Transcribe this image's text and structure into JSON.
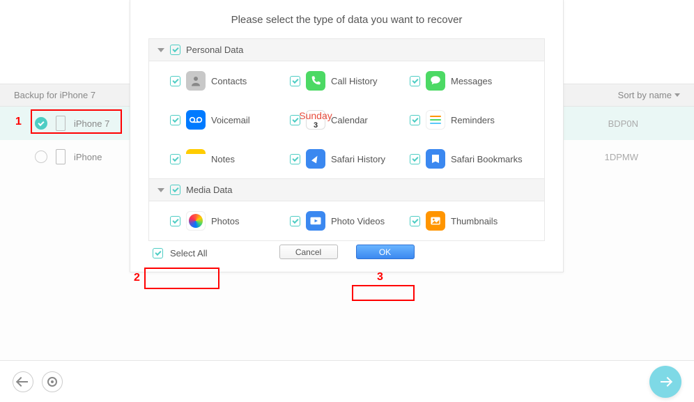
{
  "window": {
    "traffic": true
  },
  "toolbar": {
    "left": "Backup for iPhone 7",
    "sort_label": "Sort by name"
  },
  "devices": [
    {
      "name": "iPhone 7",
      "selected": true,
      "serial_tail": "BDP0N"
    },
    {
      "name": "iPhone",
      "selected": false,
      "serial_tail": "1DPMW"
    }
  ],
  "modal": {
    "title": "Please select the type of data you want to recover",
    "sections": [
      {
        "label": "Personal Data",
        "items": [
          [
            {
              "label": "Contacts",
              "icon": "contacts"
            },
            {
              "label": "Call History",
              "icon": "call"
            },
            {
              "label": "Messages",
              "icon": "msg"
            }
          ],
          [
            {
              "label": "Voicemail",
              "icon": "vm"
            },
            {
              "label": "Calendar",
              "icon": "cal"
            },
            {
              "label": "Reminders",
              "icon": "rem"
            }
          ],
          [
            {
              "label": "Notes",
              "icon": "notes"
            },
            {
              "label": "Safari History",
              "icon": "safari"
            },
            {
              "label": "Safari Bookmarks",
              "icon": "book"
            }
          ]
        ]
      },
      {
        "label": "Media Data",
        "items": [
          [
            {
              "label": "Photos",
              "icon": "photos"
            },
            {
              "label": "Photo Videos",
              "icon": "pv"
            },
            {
              "label": "Thumbnails",
              "icon": "thumb"
            }
          ]
        ]
      }
    ],
    "select_all_label": "Select All",
    "cancel_label": "Cancel",
    "ok_label": "OK",
    "calendar_day": "3",
    "calendar_wk": "Sunday"
  },
  "annotations": {
    "n1": "1",
    "n2": "2",
    "n3": "3"
  }
}
